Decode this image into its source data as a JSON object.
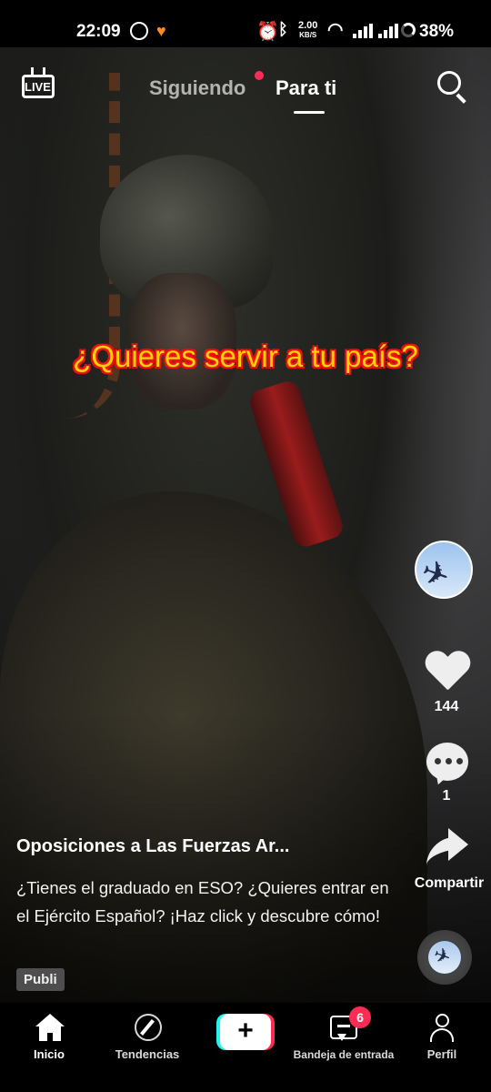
{
  "status_bar": {
    "time": "22:09",
    "net_speed_value": "2.00",
    "net_speed_unit": "KB/S",
    "battery": "38%",
    "icons": [
      "whatsapp-icon",
      "app-notification-icon",
      "alarm-icon",
      "bluetooth-icon",
      "wifi-icon",
      "signal-icon",
      "signal-icon",
      "battery-icon"
    ]
  },
  "top_nav": {
    "live_label": "LIVE",
    "tabs": [
      {
        "label": "Siguiendo",
        "active": false,
        "has_dot": true
      },
      {
        "label": "Para ti",
        "active": true
      }
    ],
    "search_icon": "search-icon"
  },
  "video": {
    "overlay_text": "¿Quieres servir a tu país?"
  },
  "actions": {
    "likes": "144",
    "comments": "1",
    "share_label": "Compartir"
  },
  "ad": {
    "title": "Oposiciones a Las Fuerzas Ar...",
    "description": "¿Tienes el graduado en ESO? ¿Quieres entrar en el Ejército Español? ¡Haz click y descubre cómo!",
    "badge": "Publi"
  },
  "bottom_nav": {
    "items": [
      {
        "label": "Inicio",
        "icon": "home-icon"
      },
      {
        "label": "Tendencias",
        "icon": "compass-icon"
      },
      {
        "label": "",
        "icon": "create-plus-icon"
      },
      {
        "label": "Bandeja de entrada",
        "icon": "inbox-icon",
        "badge": "6"
      },
      {
        "label": "Perfil",
        "icon": "profile-icon"
      }
    ]
  },
  "colors": {
    "accent_red": "#fe2c55",
    "accent_cyan": "#25f4ee",
    "overlay_text": "#ffd400",
    "overlay_outline": "#e01010"
  }
}
